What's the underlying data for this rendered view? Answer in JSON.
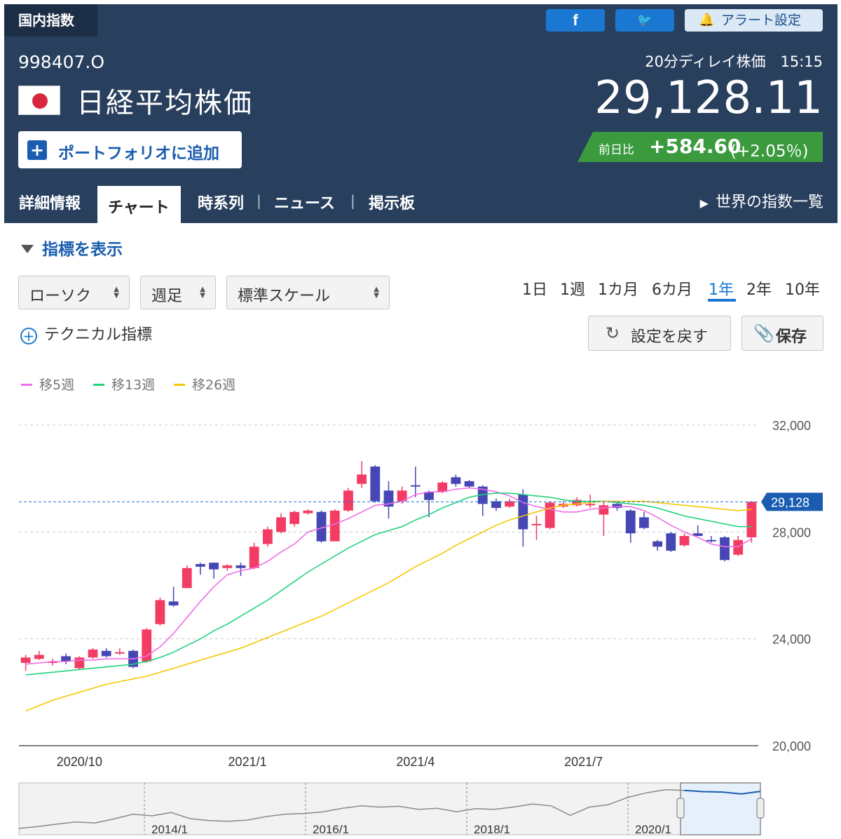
{
  "header": {
    "category": "国内指数",
    "share": {
      "facebook_label": "f",
      "twitter_label": "🐦"
    },
    "alert_label": "アラート設定",
    "code": "998407.O",
    "name": "日経平均株価",
    "portfolio_label": "ポートフォリオに追加",
    "delay_text": "20分ディレイ株価",
    "time": "15:15",
    "price": "29,128.11",
    "change_label": "前日比",
    "change": "+584.60",
    "change_pct": "(+2.05％)",
    "tabs": [
      "詳細情報",
      "チャート",
      "時系列",
      "ニュース",
      "掲示板"
    ],
    "active_tab": "チャート",
    "world_link": "世界の指数一覧"
  },
  "controls": {
    "indicator_toggle": "指標を表示",
    "chart_type": "ローソク",
    "interval": "週足",
    "scale": "標準スケール",
    "periods": [
      "1日",
      "1週",
      "1カ月",
      "6カ月",
      "1年",
      "2年",
      "10年"
    ],
    "active_period": "1年",
    "technical_label": "テクニカル指標",
    "reset_label": "設定を戻す",
    "save_label": "保存"
  },
  "colors": {
    "header_bg": "#283f5e",
    "up": "#f23c64",
    "down": "#4646b4",
    "ma5": "#ee6ee6",
    "ma13": "#1fd47c",
    "ma26": "#f5c800",
    "change_bg": "#3b9a3e",
    "accent": "#1a78d2"
  },
  "chart_data": {
    "type": "candlestick",
    "interval": "weekly",
    "yticks": [
      20000,
      24000,
      28000,
      32000
    ],
    "ylim": [
      20000,
      32000
    ],
    "ytick_labels": [
      "20,000",
      "24,000",
      "28,000",
      "32,000"
    ],
    "xtick_labels": [
      {
        "label": "2020/10",
        "index": 4
      },
      {
        "label": "2021/1",
        "index": 16.5
      },
      {
        "label": "2021/4",
        "index": 29
      },
      {
        "label": "2021/7",
        "index": 41.5
      }
    ],
    "last_price_label": "29,128",
    "last_price": 29128,
    "candles": [
      {
        "o": 23100,
        "c": 23300,
        "h": 23400,
        "l": 22800
      },
      {
        "o": 23250,
        "c": 23400,
        "h": 23550,
        "l": 23200
      },
      {
        "o": 23150,
        "c": 23150,
        "h": 23250,
        "l": 23000
      },
      {
        "o": 23350,
        "c": 23150,
        "h": 23450,
        "l": 23050
      },
      {
        "o": 22900,
        "c": 23300,
        "h": 23350,
        "l": 22850
      },
      {
        "o": 23300,
        "c": 23600,
        "h": 23650,
        "l": 23250
      },
      {
        "o": 23550,
        "c": 23350,
        "h": 23650,
        "l": 23300
      },
      {
        "o": 23450,
        "c": 23500,
        "h": 23650,
        "l": 23400
      },
      {
        "o": 23550,
        "c": 22950,
        "h": 23600,
        "l": 22900
      },
      {
        "o": 23150,
        "c": 24350,
        "h": 24400,
        "l": 23100
      },
      {
        "o": 24550,
        "c": 25450,
        "h": 25550,
        "l": 24500
      },
      {
        "o": 25400,
        "c": 25250,
        "h": 25950,
        "l": 25200
      },
      {
        "o": 25900,
        "c": 26650,
        "h": 26750,
        "l": 25900
      },
      {
        "o": 26800,
        "c": 26700,
        "h": 26850,
        "l": 26400
      },
      {
        "o": 26850,
        "c": 26600,
        "h": 26850,
        "l": 26250
      },
      {
        "o": 26650,
        "c": 26750,
        "h": 26800,
        "l": 26550
      },
      {
        "o": 26750,
        "c": 26650,
        "h": 26850,
        "l": 26350
      },
      {
        "o": 26650,
        "c": 27450,
        "h": 27600,
        "l": 26600
      },
      {
        "o": 27550,
        "c": 28100,
        "h": 28200,
        "l": 27450
      },
      {
        "o": 28000,
        "c": 28550,
        "h": 28700,
        "l": 27950
      },
      {
        "o": 28300,
        "c": 28750,
        "h": 28800,
        "l": 28200
      },
      {
        "o": 28700,
        "c": 28800,
        "h": 28850,
        "l": 28650
      },
      {
        "o": 28750,
        "c": 27650,
        "h": 28800,
        "l": 27600
      },
      {
        "o": 27650,
        "c": 28800,
        "h": 28850,
        "l": 27650
      },
      {
        "o": 28800,
        "c": 29550,
        "h": 29650,
        "l": 28750
      },
      {
        "o": 29800,
        "c": 30150,
        "h": 30650,
        "l": 29650
      },
      {
        "o": 30450,
        "c": 29150,
        "h": 30500,
        "l": 29100
      },
      {
        "o": 29550,
        "c": 28950,
        "h": 29900,
        "l": 28500
      },
      {
        "o": 29150,
        "c": 29550,
        "h": 29700,
        "l": 29050
      },
      {
        "o": 29750,
        "c": 29700,
        "h": 30450,
        "l": 29300
      },
      {
        "o": 29500,
        "c": 29200,
        "h": 29550,
        "l": 28550
      },
      {
        "o": 29500,
        "c": 29850,
        "h": 29900,
        "l": 29450
      },
      {
        "o": 30050,
        "c": 29800,
        "h": 30150,
        "l": 29700
      },
      {
        "o": 29900,
        "c": 29700,
        "h": 29950,
        "l": 29650
      },
      {
        "o": 29700,
        "c": 29050,
        "h": 29750,
        "l": 28600
      },
      {
        "o": 29150,
        "c": 28900,
        "h": 29250,
        "l": 28800
      },
      {
        "o": 28950,
        "c": 29150,
        "h": 29250,
        "l": 28900
      },
      {
        "o": 29400,
        "c": 28100,
        "h": 29600,
        "l": 27450
      },
      {
        "o": 28300,
        "c": 28300,
        "h": 28600,
        "l": 27700
      },
      {
        "o": 28150,
        "c": 29100,
        "h": 29150,
        "l": 28100
      },
      {
        "o": 28950,
        "c": 29050,
        "h": 29150,
        "l": 28900
      },
      {
        "o": 29000,
        "c": 29200,
        "h": 29300,
        "l": 28950
      },
      {
        "o": 29050,
        "c": 29050,
        "h": 29400,
        "l": 28900
      },
      {
        "o": 28650,
        "c": 29000,
        "h": 29150,
        "l": 27850
      },
      {
        "o": 29050,
        "c": 28900,
        "h": 29150,
        "l": 28800
      },
      {
        "o": 28800,
        "c": 27950,
        "h": 28850,
        "l": 27600
      },
      {
        "o": 28550,
        "c": 28150,
        "h": 28750,
        "l": 28100
      },
      {
        "o": 27650,
        "c": 27450,
        "h": 27700,
        "l": 27300
      },
      {
        "o": 27950,
        "c": 27300,
        "h": 28000,
        "l": 27250
      },
      {
        "o": 27500,
        "c": 27850,
        "h": 27950,
        "l": 27450
      },
      {
        "o": 27950,
        "c": 27850,
        "h": 28250,
        "l": 27850
      },
      {
        "o": 27700,
        "c": 27650,
        "h": 27850,
        "l": 27600
      },
      {
        "o": 27800,
        "c": 26950,
        "h": 27850,
        "l": 26900
      },
      {
        "o": 27150,
        "c": 27700,
        "h": 27850,
        "l": 27100
      },
      {
        "o": 27800,
        "c": 29128,
        "h": 29150,
        "l": 27600
      }
    ],
    "series": [
      {
        "name": "移5週",
        "color": "#ee6ee6",
        "values": [
          23050,
          23100,
          23150,
          23150,
          23200,
          23200,
          23250,
          23250,
          23250,
          23350,
          23700,
          24200,
          24800,
          25400,
          25950,
          26400,
          26550,
          26650,
          26900,
          27250,
          27550,
          28000,
          28150,
          28300,
          28500,
          28750,
          29000,
          29050,
          29150,
          29400,
          29500,
          29500,
          29600,
          29650,
          29600,
          29500,
          29350,
          29100,
          28950,
          28850,
          28750,
          28750,
          28850,
          28900,
          28950,
          28950,
          28800,
          28550,
          28250,
          28000,
          27800,
          27550,
          27450,
          27450,
          27750
        ]
      },
      {
        "name": "移13週",
        "color": "#1fd47c",
        "values": [
          22650,
          22700,
          22750,
          22800,
          22850,
          22900,
          22950,
          23000,
          23050,
          23150,
          23300,
          23500,
          23750,
          24000,
          24300,
          24550,
          24850,
          25150,
          25450,
          25800,
          26150,
          26500,
          26800,
          27100,
          27400,
          27650,
          27900,
          28050,
          28200,
          28450,
          28650,
          28900,
          29100,
          29300,
          29400,
          29450,
          29450,
          29400,
          29350,
          29300,
          29200,
          29150,
          29150,
          29150,
          29100,
          29050,
          29000,
          28900,
          28750,
          28600,
          28500,
          28400,
          28300,
          28200,
          28200
        ]
      },
      {
        "name": "移26週",
        "color": "#f5c800",
        "values": [
          21300,
          21500,
          21700,
          21850,
          22000,
          22150,
          22300,
          22400,
          22500,
          22600,
          22750,
          22900,
          23050,
          23200,
          23350,
          23500,
          23650,
          23850,
          24050,
          24250,
          24450,
          24650,
          24850,
          25100,
          25350,
          25600,
          25850,
          26100,
          26400,
          26700,
          26950,
          27200,
          27500,
          27750,
          28000,
          28250,
          28450,
          28600,
          28750,
          28900,
          29000,
          29050,
          29100,
          29150,
          29150,
          29150,
          29150,
          29100,
          29050,
          29000,
          28950,
          28900,
          28850,
          28800,
          28850
        ]
      }
    ],
    "navigator": {
      "labels": [
        "2014/1",
        "2016/1",
        "2018/1",
        "2020/1"
      ],
      "values": [
        13500,
        14300,
        15300,
        16200,
        15800,
        17500,
        19500,
        18800,
        20200,
        17600,
        16800,
        16500,
        17000,
        18500,
        19500,
        19800,
        20500,
        22000,
        23000,
        22500,
        22800,
        21500,
        22000,
        20500,
        21800,
        21500,
        22500,
        23800,
        23000,
        19000,
        22500,
        23500,
        26500,
        28500,
        29800,
        29500,
        29000,
        28800,
        28000,
        29100
      ]
    }
  }
}
